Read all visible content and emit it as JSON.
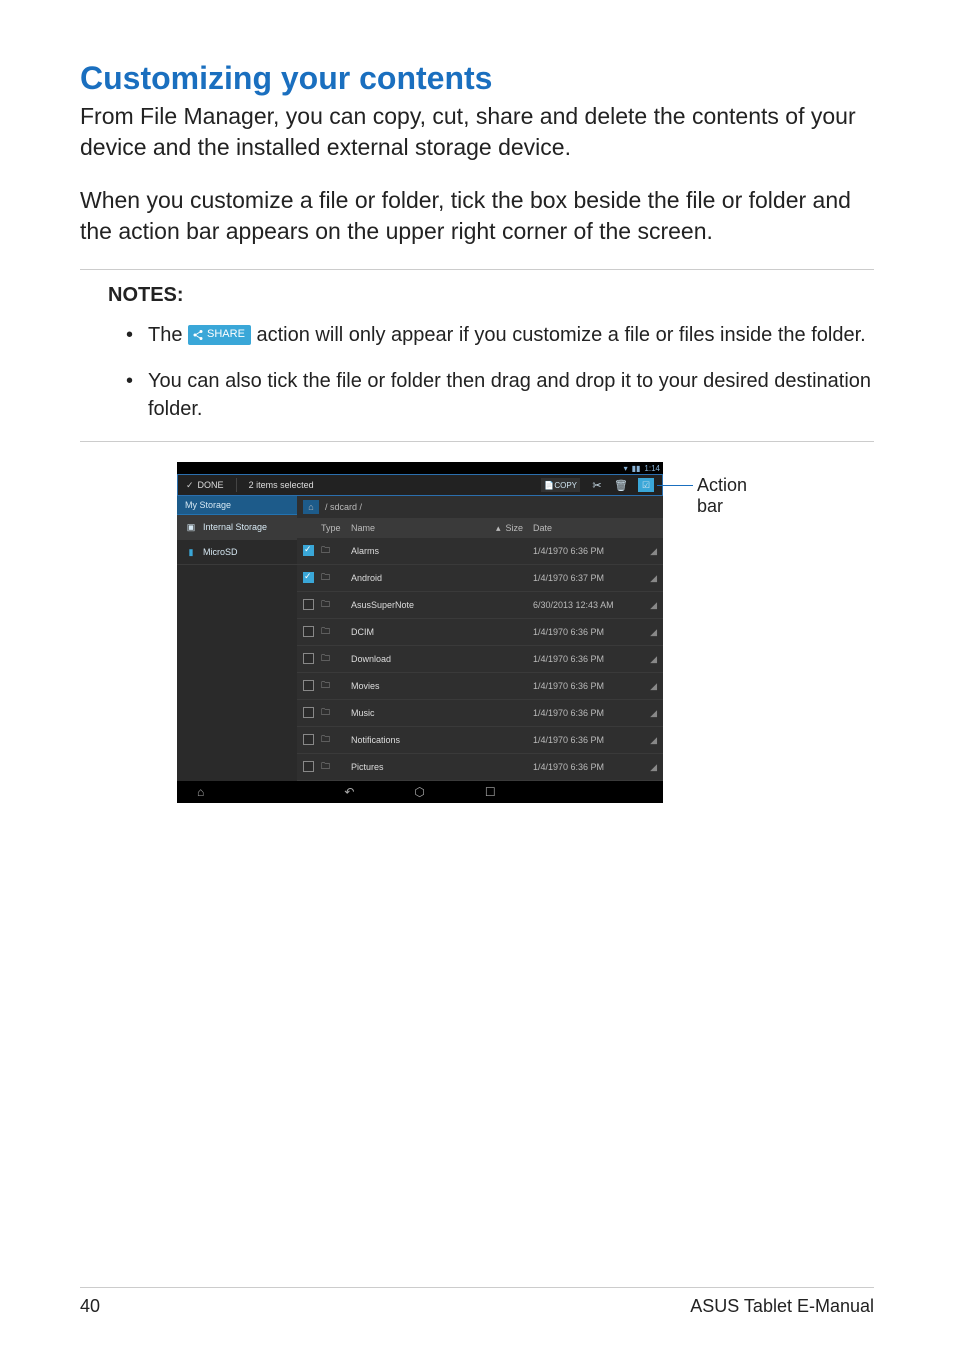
{
  "title": "Customizing your contents",
  "para1": "From File Manager, you can copy, cut, share and delete the contents of your device and the installed external storage device.",
  "para2": "When you customize a file or folder, tick the box beside the file or folder and the action bar appears on the upper right corner of the screen.",
  "notes_label": "NOTES:",
  "note1_pre": "The ",
  "share_label": "SHARE",
  "note1_post": " action will only appear if you customize a file or files inside the folder.",
  "note2": "You can also tick the file or folder then drag and drop it to your desired destination folder.",
  "callout": "Action bar",
  "status_time": "1:14",
  "actionbar": {
    "done": "DONE",
    "selected": "2 items selected",
    "copy": "COPY"
  },
  "sidebar": {
    "header": "My Storage",
    "items": [
      {
        "label": "Internal Storage"
      },
      {
        "label": "MicroSD"
      }
    ]
  },
  "breadcrumb": "/ sdcard /",
  "columns": {
    "type": "Type",
    "name": "Name",
    "size": "Size",
    "date": "Date"
  },
  "rows": [
    {
      "checked": true,
      "name": "Alarms",
      "date": "1/4/1970 6:36 PM"
    },
    {
      "checked": true,
      "name": "Android",
      "date": "1/4/1970 6:37 PM"
    },
    {
      "checked": false,
      "name": "AsusSuperNote",
      "date": "6/30/2013 12:43 AM"
    },
    {
      "checked": false,
      "name": "DCIM",
      "date": "1/4/1970 6:36 PM"
    },
    {
      "checked": false,
      "name": "Download",
      "date": "1/4/1970 6:36 PM"
    },
    {
      "checked": false,
      "name": "Movies",
      "date": "1/4/1970 6:36 PM"
    },
    {
      "checked": false,
      "name": "Music",
      "date": "1/4/1970 6:36 PM"
    },
    {
      "checked": false,
      "name": "Notifications",
      "date": "1/4/1970 6:36 PM"
    },
    {
      "checked": false,
      "name": "Pictures",
      "date": "1/4/1970 6:36 PM"
    }
  ],
  "footer": {
    "page": "40",
    "label": "ASUS Tablet E-Manual"
  }
}
